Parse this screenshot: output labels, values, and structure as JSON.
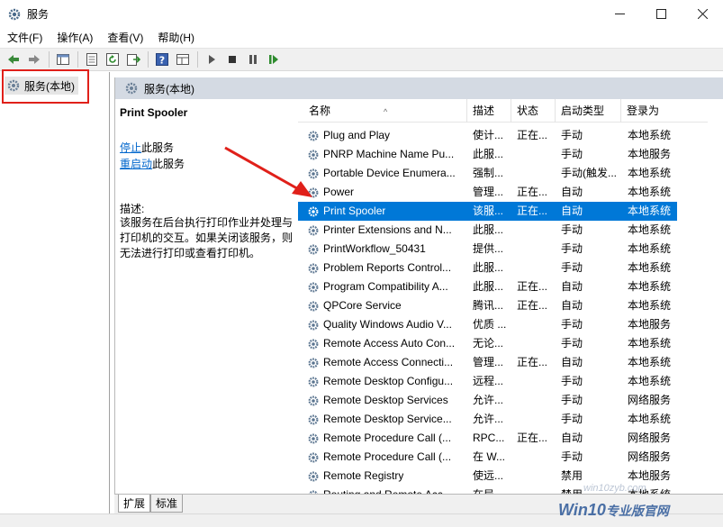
{
  "window": {
    "title": "服务",
    "icon": "gear-icon"
  },
  "menu": {
    "items": [
      "文件(F)",
      "操作(A)",
      "查看(V)",
      "帮助(H)"
    ]
  },
  "tree": {
    "item_label": "服务(本地)"
  },
  "right_header": {
    "label": "服务(本地)"
  },
  "details": {
    "service_name": "Print Spooler",
    "stop_link": "停止",
    "stop_rest": "此服务",
    "restart_link": "重启动",
    "restart_rest": "此服务",
    "desc_label": "描述:",
    "desc_text": "该服务在后台执行打印作业并处理与打印机的交互。如果关闭该服务，则无法进行打印或查看打印机。"
  },
  "columns": [
    "名称",
    "描述",
    "状态",
    "启动类型",
    "登录为"
  ],
  "services": [
    [
      "Plug and Play",
      "使计...",
      "正在...",
      "手动",
      "本地系统"
    ],
    [
      "PNRP Machine Name Pu...",
      "此服...",
      "",
      "手动",
      "本地服务"
    ],
    [
      "Portable Device Enumera...",
      "强制...",
      "",
      "手动(触发...",
      "本地系统"
    ],
    [
      "Power",
      "管理...",
      "正在...",
      "自动",
      "本地系统"
    ],
    [
      "Print Spooler",
      "该服...",
      "正在...",
      "自动",
      "本地系统"
    ],
    [
      "Printer Extensions and N...",
      "此服...",
      "",
      "手动",
      "本地系统"
    ],
    [
      "PrintWorkflow_50431",
      "提供...",
      "",
      "手动",
      "本地系统"
    ],
    [
      "Problem Reports Control...",
      "此服...",
      "",
      "手动",
      "本地系统"
    ],
    [
      "Program Compatibility A...",
      "此服...",
      "正在...",
      "自动",
      "本地系统"
    ],
    [
      "QPCore Service",
      "腾讯...",
      "正在...",
      "自动",
      "本地系统"
    ],
    [
      "Quality Windows Audio V...",
      "优质 ...",
      "",
      "手动",
      "本地服务"
    ],
    [
      "Remote Access Auto Con...",
      "无论...",
      "",
      "手动",
      "本地系统"
    ],
    [
      "Remote Access Connecti...",
      "管理...",
      "正在...",
      "自动",
      "本地系统"
    ],
    [
      "Remote Desktop Configu...",
      "远程...",
      "",
      "手动",
      "本地系统"
    ],
    [
      "Remote Desktop Services",
      "允许...",
      "",
      "手动",
      "网络服务"
    ],
    [
      "Remote Desktop Service...",
      "允许...",
      "",
      "手动",
      "本地系统"
    ],
    [
      "Remote Procedure Call (...",
      "RPC...",
      "正在...",
      "自动",
      "网络服务"
    ],
    [
      "Remote Procedure Call (...",
      "在 W...",
      "",
      "手动",
      "网络服务"
    ],
    [
      "Remote Registry",
      "使远...",
      "",
      "禁用",
      "本地服务"
    ],
    [
      "Routing and Remote Acc...",
      "在局...",
      "",
      "禁用",
      "本地系统"
    ]
  ],
  "selected_index": 4,
  "tabs": [
    "扩展",
    "标准"
  ],
  "watermark": {
    "url": "win10zyb.com",
    "brand_prefix": "Win10",
    "brand_suffix": "专业版官网"
  },
  "colors": {
    "selection": "#0078d7",
    "annotation_red": "#e0201a",
    "link": "#0066cc"
  }
}
